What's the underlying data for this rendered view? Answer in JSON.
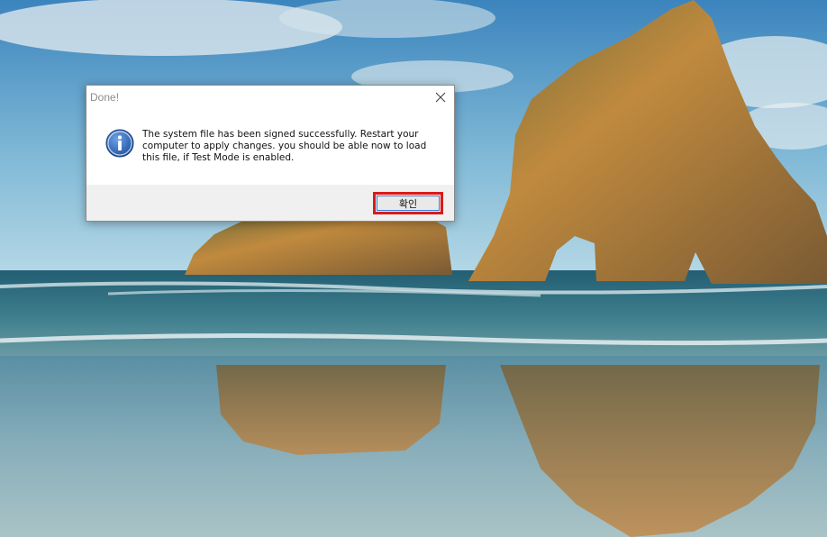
{
  "dialog": {
    "title": "Done!",
    "message": "The system file has been signed successfully. Restart your computer to apply changes. you should be able now to load this file, if Test Mode is enabled.",
    "ok_label": "확인",
    "icon": "information-icon",
    "close_icon": "close-icon"
  },
  "colors": {
    "highlight_border": "#d81b1b",
    "footer_bg": "#f0f0f0"
  }
}
